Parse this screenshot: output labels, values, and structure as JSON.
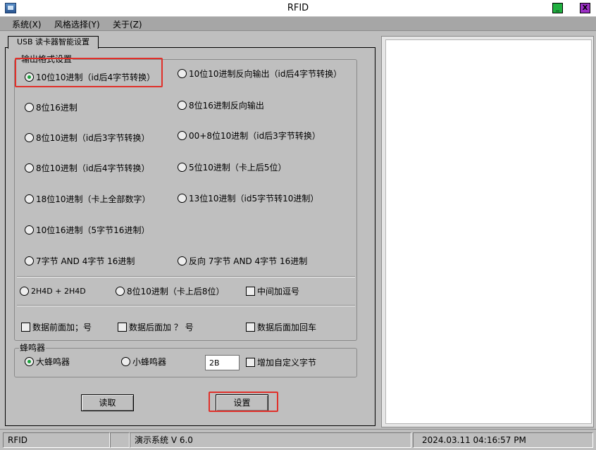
{
  "window": {
    "title": "RFID"
  },
  "menu": {
    "items": [
      "系统(X)",
      "风格选择(Y)",
      "关于(Z)"
    ]
  },
  "tab": {
    "label": "USB 读卡器智能设置"
  },
  "output_group": {
    "legend": "输出格式设置",
    "options": [
      {
        "label": "10位10进制（id后4字节转换）",
        "selected": true
      },
      {
        "label": "10位10进制反向输出（id后4字节转换）",
        "selected": false
      },
      {
        "label": "8位16进制",
        "selected": false
      },
      {
        "label": "8位16进制反向输出",
        "selected": false
      },
      {
        "label": "8位10进制（id后3字节转换）",
        "selected": false
      },
      {
        "label": "00+8位10进制（id后3字节转换）",
        "selected": false
      },
      {
        "label": "8位10进制（id后4字节转换）",
        "selected": false
      },
      {
        "label": "5位10进制（卡上后5位）",
        "selected": false
      },
      {
        "label": "18位10进制（卡上全部数字）",
        "selected": false
      },
      {
        "label": "13位10进制（id5字节转10进制）",
        "selected": false
      },
      {
        "label": "10位16进制（5字节16进制）",
        "selected": false
      },
      {
        "label": "7字节 AND 4字节 16进制",
        "selected": false
      },
      {
        "label": "反向 7字节 AND 4字节 16进制",
        "selected": false
      },
      {
        "label": "2H4D + 2H4D",
        "selected": false
      },
      {
        "label": "8位10进制（卡上后8位）",
        "selected": false
      }
    ],
    "checkboxes": [
      {
        "label": "中间加逗号",
        "checked": false
      },
      {
        "label": "数据前面加；号",
        "checked": false
      },
      {
        "label": "数据后面加 ？ 号",
        "checked": false
      },
      {
        "label": "数据后面加回车",
        "checked": false
      }
    ]
  },
  "buzzer_group": {
    "legend": "蜂鸣器",
    "options": [
      {
        "label": "大蜂鸣器",
        "selected": true
      },
      {
        "label": "小蜂鸣器",
        "selected": false
      }
    ],
    "custom_byte_value": "2B",
    "custom_byte_label": "增加自定义字节",
    "custom_byte_checked": false
  },
  "buttons": {
    "read": "读取",
    "set": "设置"
  },
  "status": {
    "app": "RFID",
    "blank": "",
    "system": "演示系统  V 6.0",
    "datetime": "2024.03.11    04:16:57 PM"
  },
  "colors": {
    "highlight_box": "#e0302a",
    "radio_dot": "#1aa33c",
    "minimize": "#20b040",
    "close": "#9b30c4"
  }
}
